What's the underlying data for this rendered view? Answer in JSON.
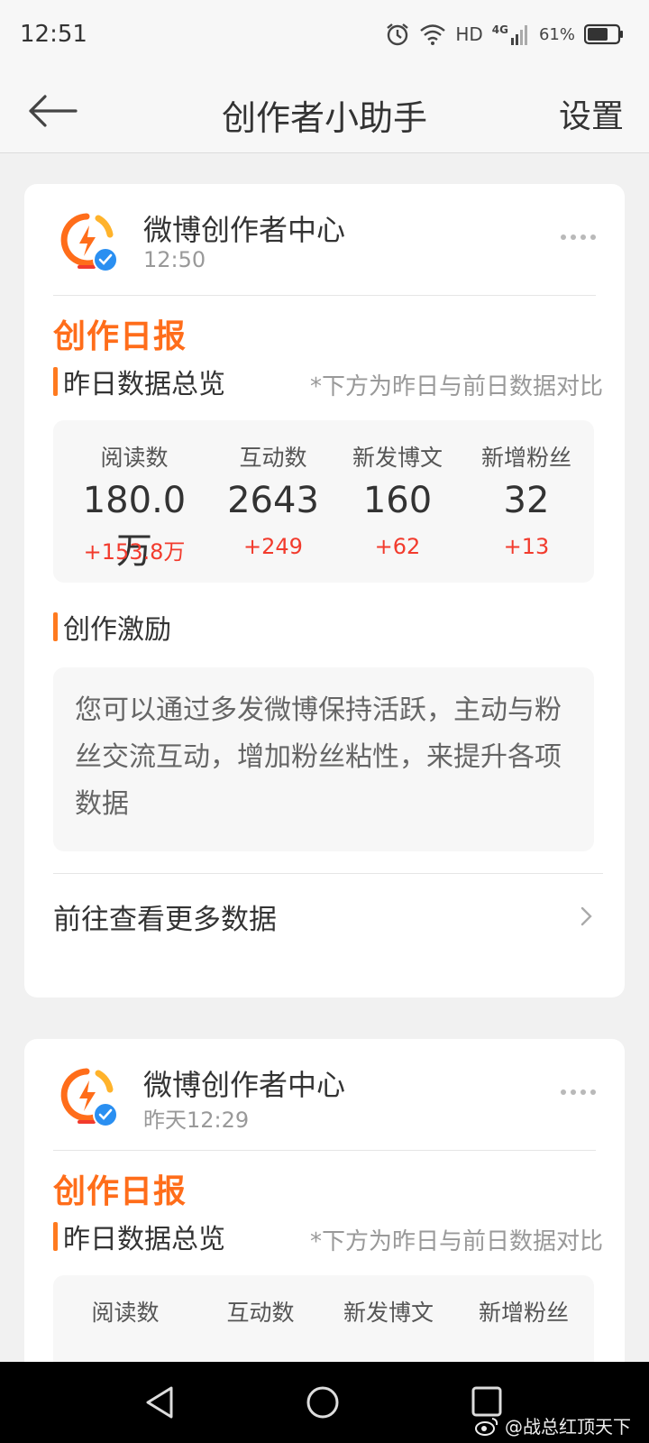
{
  "status_bar": {
    "time": "12:51",
    "hd": "HD",
    "network": "4G",
    "battery": "61%"
  },
  "nav": {
    "title": "创作者小助手",
    "settings": "设置",
    "back_icon": "back-arrow-icon"
  },
  "cards": [
    {
      "sender": "微博创作者中心",
      "time": "12:50",
      "report_title": "创作日报",
      "overview_title": "昨日数据总览",
      "overview_note": "*下方为昨日与前日数据对比",
      "stats": [
        {
          "label": "阅读数",
          "value": "180.0万",
          "delta": "+153.8万"
        },
        {
          "label": "互动数",
          "value": "2643",
          "delta": "+249"
        },
        {
          "label": "新发博文",
          "value": "160",
          "delta": "+62"
        },
        {
          "label": "新增粉丝",
          "value": "32",
          "delta": "+13"
        }
      ],
      "incentive_title": "创作激励",
      "incentive_text": "您可以通过多发微博保持活跃，主动与粉丝交流互动，增加粉丝粘性，来提升各项数据",
      "more_link": "前往查看更多数据"
    },
    {
      "sender": "微博创作者中心",
      "time": "昨天12:29",
      "report_title": "创作日报",
      "overview_title": "昨日数据总览",
      "overview_note": "*下方为昨日与前日数据对比",
      "stats": [
        {
          "label": "阅读数"
        },
        {
          "label": "互动数"
        },
        {
          "label": "新发博文"
        },
        {
          "label": "新增粉丝"
        }
      ]
    }
  ],
  "watermark": "@战总红顶天下",
  "colors": {
    "accent_orange": "#ff6d1a",
    "delta_red": "#f23b2d",
    "verified_blue": "#2a8ff1"
  }
}
